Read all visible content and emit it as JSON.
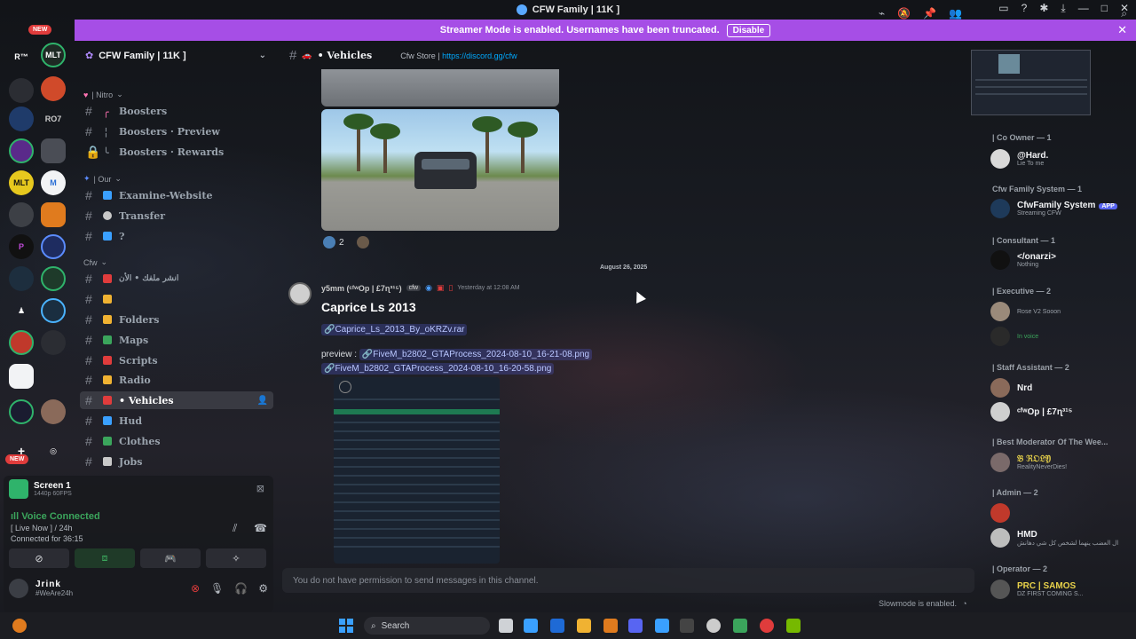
{
  "window": {
    "title": "CFW Family | 11K ]"
  },
  "banner": {
    "text": "Streamer Mode is enabled. Usernames have been truncated.",
    "button": "Disable"
  },
  "rail": {
    "new_top": "NEW",
    "new_bottom": "NEW",
    "labels": [
      "R™",
      "RO7",
      "MLT"
    ]
  },
  "sidebar": {
    "server_name": "CFW Family | 11K ]",
    "categories": {
      "nitro": "| Nitro",
      "our": "| Our",
      "cfw": "Cfw"
    },
    "channels": [
      {
        "label": "Boosters"
      },
      {
        "label": "Boosters · Preview"
      },
      {
        "label": "Boosters · Rewards"
      },
      {
        "label": "Examine-Website"
      },
      {
        "label": "Transfer"
      },
      {
        "label": "?"
      },
      {
        "label": "انشر ملفك • الأن"
      },
      {
        "label": ""
      },
      {
        "label": "Folders"
      },
      {
        "label": "Maps"
      },
      {
        "label": "Scripts"
      },
      {
        "label": "Radio"
      },
      {
        "label": "• Vehicles"
      },
      {
        "label": "Hud"
      },
      {
        "label": "Clothes"
      },
      {
        "label": "Jobs"
      }
    ]
  },
  "panel": {
    "screen_title": "Screen 1",
    "screen_sub": "1440p 60FPS",
    "voice_connected": "Voice Connected",
    "voice_channel": "[ Live Now ] / 24h",
    "connected_for": "Connected for 36:15",
    "username": "Jrink",
    "user_status": "#WeAre24h"
  },
  "chat": {
    "channel_name": "• Vehicles",
    "topic_prefix": "Cfw Store |",
    "topic_link": "https://discord.gg/cfw",
    "reaction_count": "2",
    "date_separator": "August 26, 2025",
    "author": "y5mm (ᶜᶠʷOp | £7ɳ³¹⁵)",
    "author_tag": "cfw",
    "timestamp": "Yesterday at 12:08 AM",
    "title": "Caprice Ls 2013",
    "file_link": "Caprice_Ls_2013_By_oKRZv.rar",
    "preview_label": "preview :",
    "preview_link_1": "FiveM_b2802_GTAProcess_2024-08-10_16-21-08.png",
    "preview_link_2": "FiveM_b2802_GTAProcess_2024-08-10_16-20-58.png",
    "composer_placeholder": "You do not have permission to send messages in this channel.",
    "slowmode": "Slowmode is enabled."
  },
  "members": {
    "roles": [
      {
        "header": "| Co Owner — 1"
      },
      {
        "header": "Cfw Family System — 1"
      },
      {
        "header": "| Consultant — 1"
      },
      {
        "header": "| Executive — 2"
      },
      {
        "header": "| Staff Assistant — 2"
      },
      {
        "header": "| Best Moderator Of The Wee..."
      },
      {
        "header": "| Admin — 2"
      },
      {
        "header": "| Operator — 2"
      }
    ],
    "people": [
      {
        "name": "@Hard.",
        "status": "Lie To me"
      },
      {
        "name": "CfwFamily System",
        "tag": "APP",
        "status": "Streaming CFW"
      },
      {
        "name": "</onarzi>",
        "status": "Nothing"
      },
      {
        "name": "",
        "status": "Rose V2 Sooon"
      },
      {
        "name": "",
        "status": "In voice"
      },
      {
        "name": "Nrd",
        "status": ""
      },
      {
        "name": "ᶜᶠʷOp | £7ɳ³¹⁵",
        "status": ""
      },
      {
        "name": "𝔅 ℜ𝔒𝔏𝔜",
        "status": "RealityNeverDies!"
      },
      {
        "name": "",
        "status": ""
      },
      {
        "name": "HMD",
        "status": "ال العضب ينهما لشخص كل شي دهانش"
      },
      {
        "name": "PRC | SAMOS",
        "status": "DZ FIRST COMING S..."
      }
    ]
  },
  "taskbar": {
    "search_placeholder": "Search"
  },
  "colors": {
    "banner": "#a64ee6",
    "accent": "#5865f2",
    "voice_green": "#3ba55c"
  }
}
